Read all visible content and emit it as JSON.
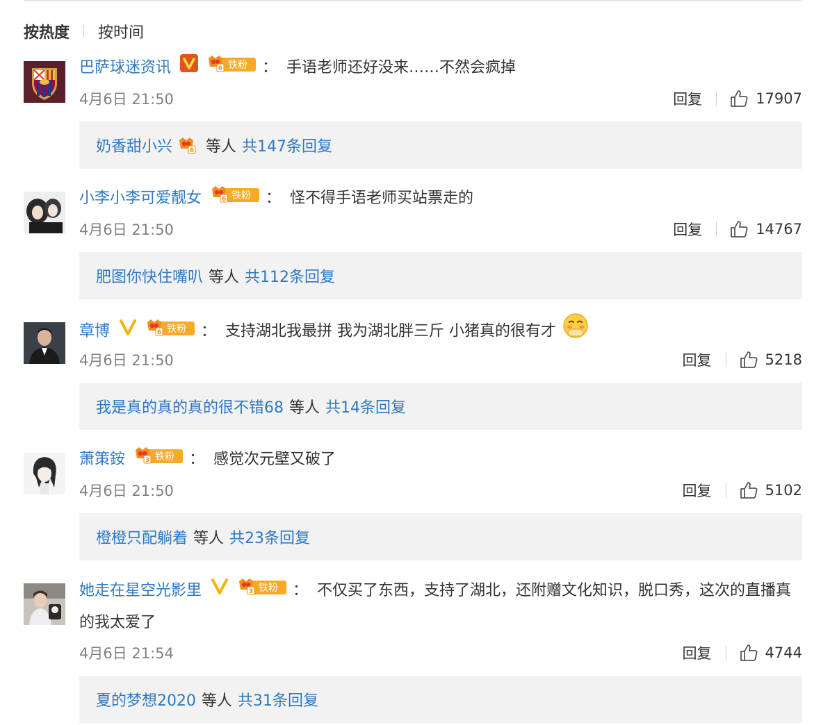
{
  "sort": {
    "hot": "按热度",
    "time": "按时间"
  },
  "common": {
    "reply": "回复",
    "etc": "等人",
    "colon": "："
  },
  "fan_badge_text": "铁粉",
  "colors": {
    "link": "#2d78c4",
    "meta": "#808080",
    "box": "#f2f2f2",
    "badge_orange": "#f7a928"
  },
  "comments": [
    {
      "username": "巴萨球迷资讯",
      "verified": "red-v",
      "fan_level": "6",
      "text": "手语老师还好没来……不然会疯掉",
      "time": "4月6日 21:50",
      "likes": "17907",
      "sub": {
        "user": "奶香甜小兴",
        "total": "共147条回复"
      }
    },
    {
      "username": "小李小李可爱靓女",
      "verified": "",
      "fan_level": "6",
      "text": "怪不得手语老师买站票走的",
      "time": "4月6日 21:50",
      "likes": "14767",
      "sub": {
        "user": "肥图你快住嘴叭",
        "total": "共112条回复"
      }
    },
    {
      "username": "章博",
      "verified": "yellow-v",
      "fan_level": "6",
      "text": "支持湖北我最拼 我为湖北胖三斤  小猪真的很有才",
      "time": "4月6日 21:50",
      "likes": "5218",
      "sub": {
        "user": "我是真的真的真的很不错68",
        "total": "共14条回复"
      }
    },
    {
      "username": "萧策銨",
      "verified": "",
      "fan_level": "3",
      "text": "感觉次元壁又破了",
      "time": "4月6日 21:50",
      "likes": "5102",
      "sub": {
        "user": "橙橙只配躺着",
        "total": "共23条回复"
      }
    },
    {
      "username": "她走在星空光影里",
      "verified": "yellow-v",
      "fan_level": "3",
      "text": "不仅买了东西，支持了湖北，还附赠文化知识，脱口秀，这次的直播真的我太爱了",
      "time": "4月6日 21:54",
      "likes": "4744",
      "sub": {
        "user": "夏的梦想2020",
        "total": "共31条回复"
      }
    }
  ]
}
